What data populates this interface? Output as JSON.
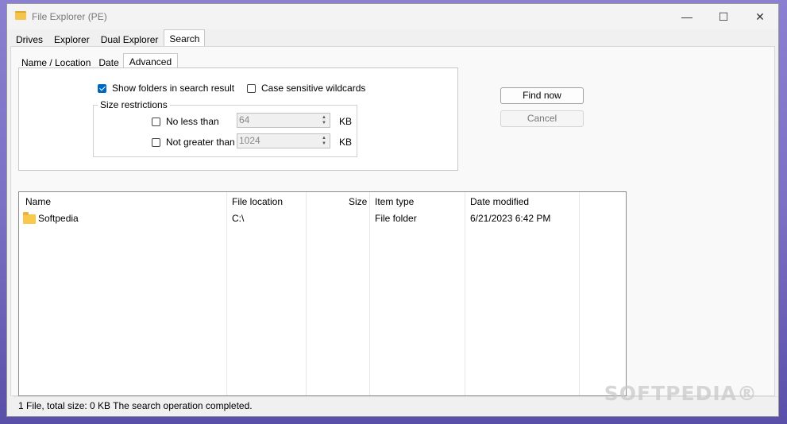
{
  "window": {
    "title": "File Explorer (PE)"
  },
  "controls": {
    "minimize": "—",
    "maximize": "☐",
    "close": "✕"
  },
  "tabs": [
    {
      "label": "Drives"
    },
    {
      "label": "Explorer"
    },
    {
      "label": "Dual Explorer"
    },
    {
      "label": "Search"
    }
  ],
  "subtabs": [
    {
      "label": "Name / Location"
    },
    {
      "label": "Date"
    },
    {
      "label": "Advanced"
    }
  ],
  "advanced": {
    "show_folders_label": "Show folders in search result",
    "show_folders_checked": true,
    "case_sensitive_label": "Case sensitive wildcards",
    "case_sensitive_checked": false,
    "size_group_label": "Size restrictions",
    "no_less_than_label": "No less than",
    "no_less_than_value": "64",
    "not_greater_than_label": "Not greater than",
    "not_greater_than_value": "1024",
    "unit": "KB"
  },
  "buttons": {
    "find_now": "Find now",
    "cancel": "Cancel"
  },
  "results": {
    "columns": [
      "Name",
      "File location",
      "Size",
      "Item type",
      "Date modified"
    ],
    "rows": [
      {
        "name": "Softpedia",
        "location": "C:\\",
        "size": "",
        "type": "File folder",
        "date": "6/21/2023 6:42 PM"
      }
    ]
  },
  "status": {
    "text": "1 File, total size: 0 KB  The search operation completed."
  },
  "watermark": "SOFTPEDIA®"
}
